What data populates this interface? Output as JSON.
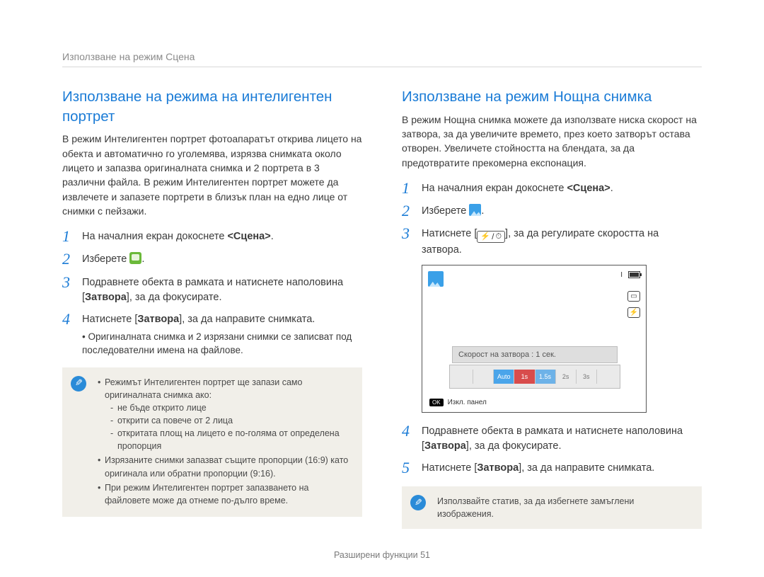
{
  "breadcrumb": "Използване на режим Сцена",
  "left": {
    "title": "Използване на режима на интелигентен портрет",
    "intro": "В режим Интелигентен портрет фотоапаратът открива лицето на обекта и автоматично го уголемява, изрязва снимката около лицето и запазва оригиналната снимка и 2 портрета в 3 различни файла. В режим Интелигентен портрет можете да извлечете и запазете портрети в близък план на едно лице от снимки с пейзажи.",
    "step1_a": "На началния екран докоснете ",
    "step1_strong": "<Сцена>",
    "step1_b": ".",
    "step2": "Изберете ",
    "step2_b": ".",
    "step3_a": "Подравнете обекта в рамката и натиснете наполовина [",
    "step3_strong": "Затвора",
    "step3_b": "], за да фокусирате.",
    "step4_a": "Натиснете [",
    "step4_strong": "Затвора",
    "step4_b": "], за да направите снимката.",
    "step4_sub": "Оригиналната снимка и 2 изрязани снимки се записват под последователни имена на файлове.",
    "note1": "Режимът Интелигентен портрет ще запази само оригиналната снимка ако:",
    "note1_sub1": "не бъде открито лице",
    "note1_sub2": "открити са повече от 2 лица",
    "note1_sub3": "откритата площ на лицето е по-голяма от определена пропорция",
    "note2": "Изрязаните снимки запазват същите пропорции (16:9) като оригинала или обратни пропорции (9:16).",
    "note3": "При режим Интелигентен портрет запазването на файловете може да отнеме по-дълго време."
  },
  "right": {
    "title": "Използване на режим Нощна снимка",
    "intro": "В режим Нощна снимка можете да използвате ниска скорост на затвора, за да увеличите времето, през което затворът остава отворен. Увеличете стойността на блендата, за да предотвратите прекомерна експонация.",
    "step1_a": "На началния екран докоснете ",
    "step1_strong": "<Сцена>",
    "step1_b": ".",
    "step2": "Изберете ",
    "step2_b": ".",
    "step3_a": "Натиснете [",
    "step3_b": "], за да регулирате скоростта на затвора.",
    "lcd": {
      "shutter_label": "Скорост на затвора : 1 сек.",
      "scale": [
        "",
        "",
        "Auto",
        "1s",
        "1.5s",
        "2s",
        "3s",
        ""
      ],
      "bottom_label": "Изкл. панел",
      "ok_badge": "OK",
      "bar_text": "I"
    },
    "step4_a": "Подравнете обекта в рамката и натиснете наполовина [",
    "step4_strong": "Затвора",
    "step4_b": "], за да фокусирате.",
    "step5_a": "Натиснете [",
    "step5_strong": "Затвора",
    "step5_b": "], за да направите снимката.",
    "note": "Използвайте статив, за да избегнете замъглени изображения."
  },
  "footer_a": "Разширени функции  ",
  "footer_b": "51"
}
